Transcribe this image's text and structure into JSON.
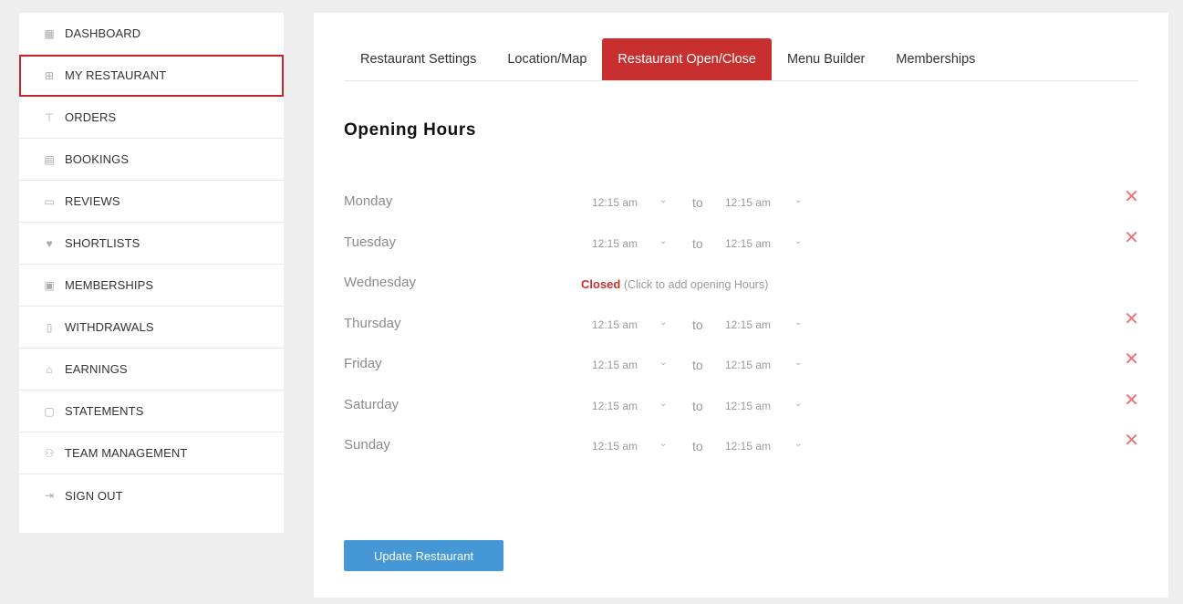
{
  "sidebar": {
    "items": [
      {
        "label": "DASHBOARD",
        "icon": "dashboard-icon",
        "glyph": "▦"
      },
      {
        "label": "MY RESTAURANT",
        "icon": "restaurant-icon",
        "glyph": "⊞",
        "active": true
      },
      {
        "label": "ORDERS",
        "icon": "cart-icon",
        "glyph": "⊤"
      },
      {
        "label": "BOOKINGS",
        "icon": "bookings-icon",
        "glyph": "▤"
      },
      {
        "label": "REVIEWS",
        "icon": "reviews-icon",
        "glyph": "▭"
      },
      {
        "label": "SHORTLISTS",
        "icon": "heart-icon",
        "glyph": "♥"
      },
      {
        "label": "MEMBERSHIPS",
        "icon": "membership-card-icon",
        "glyph": "▣"
      },
      {
        "label": "WITHDRAWALS",
        "icon": "withdrawals-icon",
        "glyph": "▯"
      },
      {
        "label": "EARNINGS",
        "icon": "earnings-icon",
        "glyph": "⌂"
      },
      {
        "label": "STATEMENTS",
        "icon": "statements-icon",
        "glyph": "▢"
      },
      {
        "label": "TEAM MANAGEMENT",
        "icon": "team-icon",
        "glyph": "⚇"
      },
      {
        "label": "SIGN OUT",
        "icon": "sign-out-icon",
        "glyph": "⇥"
      }
    ]
  },
  "tabs": [
    {
      "label": "Restaurant Settings"
    },
    {
      "label": "Location/Map"
    },
    {
      "label": "Restaurant Open/Close",
      "active": true
    },
    {
      "label": "Menu Builder"
    },
    {
      "label": "Memberships"
    }
  ],
  "heading": "Opening Hours",
  "to_label": "to",
  "closed_label": "Closed",
  "closed_note": "(Click to add opening Hours)",
  "days": [
    {
      "day": "Monday",
      "open": "12:15 am",
      "close": "12:15 am",
      "closed": false
    },
    {
      "day": "Tuesday",
      "open": "12:15 am",
      "close": "12:15 am",
      "closed": false
    },
    {
      "day": "Wednesday",
      "closed": true
    },
    {
      "day": "Thursday",
      "open": "12:15 am",
      "close": "12:15 am",
      "closed": false
    },
    {
      "day": "Friday",
      "open": "12:15 am",
      "close": "12:15 am",
      "closed": false
    },
    {
      "day": "Saturday",
      "open": "12:15 am",
      "close": "12:15 am",
      "closed": false
    },
    {
      "day": "Sunday",
      "open": "12:15 am",
      "close": "12:15 am",
      "closed": false
    }
  ],
  "update_button": "Update Restaurant",
  "colors": {
    "accent": "#c8302f",
    "button": "#4597d6",
    "remove": "#e9747a"
  }
}
